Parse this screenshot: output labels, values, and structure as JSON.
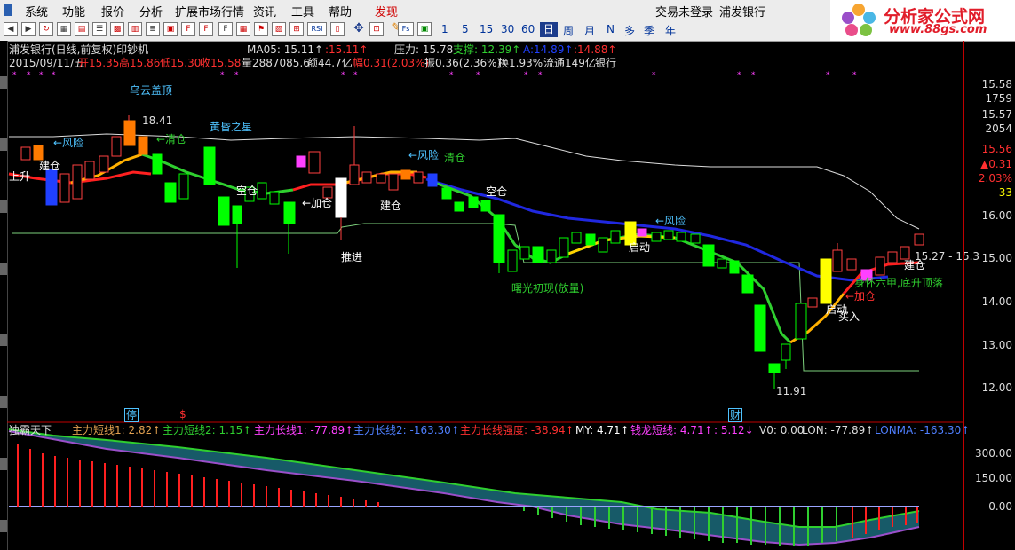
{
  "menu": {
    "items": [
      "系统",
      "功能",
      "报价",
      "分析",
      "扩展市场行情",
      "资讯",
      "工具",
      "帮助",
      "发现"
    ]
  },
  "toolbar": {
    "periods": [
      "1",
      "5",
      "15",
      "30",
      "60",
      "日",
      "周",
      "月",
      "N",
      "多",
      "季",
      "年"
    ],
    "icons": [
      "Fs",
      "RSI"
    ],
    "login_status": "交易未登录",
    "stock_name": "浦发银行"
  },
  "logo": {
    "title": "分析家公式网",
    "url": "www.88gs.com"
  },
  "chart_header": {
    "title": "浦发银行(日线,前复权)印钞机",
    "ma_label": "MA05: 15.11↑",
    "ma_red": ":15.11↑",
    "pressure": "压力: 15.78",
    "support": "支撑: 12.39↑",
    "blue_val": "A:14.89↑",
    "red_val": ":14.88↑",
    "info_date": "2015/09/11/五",
    "info_open": "开15.35",
    "info_high": "高15.86",
    "info_low": "低15.30",
    "info_close": "收15.58",
    "info_vol": "量2887085.6",
    "info_amount": "额44.7亿",
    "info_change": "幅0.31(2.03%)",
    "info_amp": "振0.36(2.36%)",
    "info_turnover": "换1.93%",
    "info_float": "流通149亿",
    "info_sector": "银行"
  },
  "price_axis": {
    "top_values": [
      "15.58",
      "1759",
      "15.57",
      "2054",
      "15.56",
      "▲0.31",
      "2.03%",
      "33"
    ],
    "ticks": [
      "16.00",
      "15.00",
      "14.00",
      "13.00",
      "12.00"
    ]
  },
  "annotations": {
    "wuyun": "乌云盖顶",
    "high": "18.41",
    "huanghun": "黄昏之星",
    "risk1": "←风险",
    "risk2": "←风险",
    "risk3": "←风险",
    "qingcang1": "←清仓",
    "qingcang2": "清仓",
    "jiancang1": "建仓",
    "jiancang2": "建仓",
    "jiancang3": "建仓",
    "kongcang1": "空仓",
    "kongcang2": "空仓",
    "jiacang1": "←加仓",
    "jiacang2": "←加仓",
    "tuijin": "推进",
    "shangsheng": "上升",
    "qidong1": "启动",
    "qidong2": "启动",
    "shuguang": "曙光初现(放量)",
    "low": "11.91",
    "mairu": "买入",
    "shenhuai": "身怀六甲,底升顶落",
    "last_price": "15.27 - 15.3",
    "ting": "停",
    "dollar": "$",
    "cai": "财"
  },
  "indicator": {
    "name": "独霸天下",
    "line1": "主力短线1: 2.82↑",
    "line2": "主力短线2: 1.15↑",
    "line3": "主力长线1: -77.89↑",
    "line4": "主力长线2: -163.30↑",
    "line5": "主力长线强度: -38.94↑",
    "my": "MY: 4.71↑",
    "qianlong": "钱龙短线: 4.71↑",
    "pink": ": 5.12↓",
    "v0": "V0: 0.00",
    "lon": "LON: -77.89↑",
    "lonma": "LONMA: -163.30↑",
    "ticks": [
      "300.00",
      "150.00",
      "0.00"
    ]
  },
  "colors": {
    "up": "#ff3030",
    "down": "#00ff00",
    "accent": "#1c3c8c",
    "axis": "#c00000"
  }
}
